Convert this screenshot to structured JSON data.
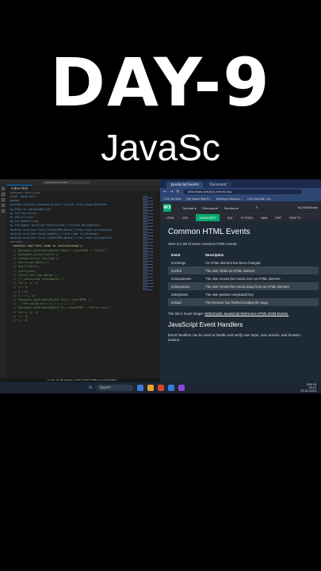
{
  "overlay": {
    "title": "DAY-9",
    "subtitle": "JavaSc"
  },
  "vscode": {
    "search": "javascript tutorials",
    "tab": "index.html",
    "breadcrumb": "index.html > html > body",
    "code_lines": [
      "<html lang=\"en\">",
      "<body>",
      "",
      "<button onclick=\"window.print()\">print this page</button>",
      "<p>this is paragraph</p>",
      "",
      "<p id=\"fun\"></p>",
      "<p id=\"u\"></p>",
      "<p id=\"demo\"></p>",
      "<p id=\"game\" onclick=\"myFunction()\">click me</button>",
      "",
      "<button onclick=\"this.innerHTML=Date()\">the time is</button>",
      "<button onclick=\"displayDate()\">the time is</button>",
      "<button onclick=\"this.innerHTML=Date()\">the time is</button>",
      "<script>",
      "  console.log(\"this code is initializing\");",
      "  // document.getElementById(\"demo\").innerHTML = \"hello\";",
      "  // document.write(\"hello\");",
      "  // window.alert(\"testing\");",
      "  // alert(new Date());",
      "  // alert(hello);",
      "  // alert(two);",
      "  // alert(\"are you doing\");",
      "",
      "  // /* javascript statements */ -",
      "",
      "  // let x, y, z;",
      "  // x = 5;",
      "  // y = 6;",
      "  // z = x + y;",
      "  // document.getElementById(\"fun\").innerHTML =",
      "  //   \"the value of z is \" + z + \".\";",
      "  // document.getElementById(\"u\").innerHTML = \"hello uniy\";",
      "",
      "  // let x, y, z;",
      "  // x = 5;",
      "  // y = 6;"
    ],
    "status": "Ln 31, Col 36   Spaces: 2   UTF-8   CRLF   HTML   Go Live   Prettier"
  },
  "browser": {
    "tabs": [
      "JavaScript Events",
      "Document"
    ],
    "url": "w3schools.com/js/js_events.asp",
    "bookmarks": [
      "(718) YouTube",
      "(48) Sigma Web D...",
      "Building a Respons...",
      "CSS Checklist | Co..."
    ],
    "w3": {
      "logo": "W3",
      "menu": [
        "Tutorials ▾",
        "Exercises ▾",
        "Services ▾"
      ],
      "my": "My W3Schools",
      "subnav": [
        "HTML",
        "CSS",
        "JAVASCRIPT",
        "SQL",
        "PYTHON",
        "JAVA",
        "PHP",
        "HOW TO"
      ],
      "active_subnav": "JAVASCRIPT",
      "heading": "Common HTML Events",
      "intro": "Here is a list of some common HTML events:",
      "table_headers": [
        "Event",
        "Description"
      ],
      "table_rows": [
        [
          "onchange",
          "An HTML element has been changed"
        ],
        [
          "onclick",
          "The user clicks an HTML element"
        ],
        [
          "onmouseover",
          "The user moves the mouse over an HTML element"
        ],
        [
          "onmouseout",
          "The user moves the mouse away from an HTML element"
        ],
        [
          "onkeydown",
          "The user pushes a keyboard key"
        ],
        [
          "onload",
          "The browser has finished loading the page"
        ]
      ],
      "more_prefix": "The list is much longer: ",
      "more_link": "W3Schools JavaScript Reference HTML DOM Events.",
      "heading2": "JavaScript Event Handlers",
      "handlers_text": "Event handlers can be used to handle and verify user input, user actions, and browser actions:"
    }
  },
  "taskbar": {
    "search": "Search",
    "time": "19:53",
    "date": "29-03-2024",
    "lang": "ENG IN"
  }
}
